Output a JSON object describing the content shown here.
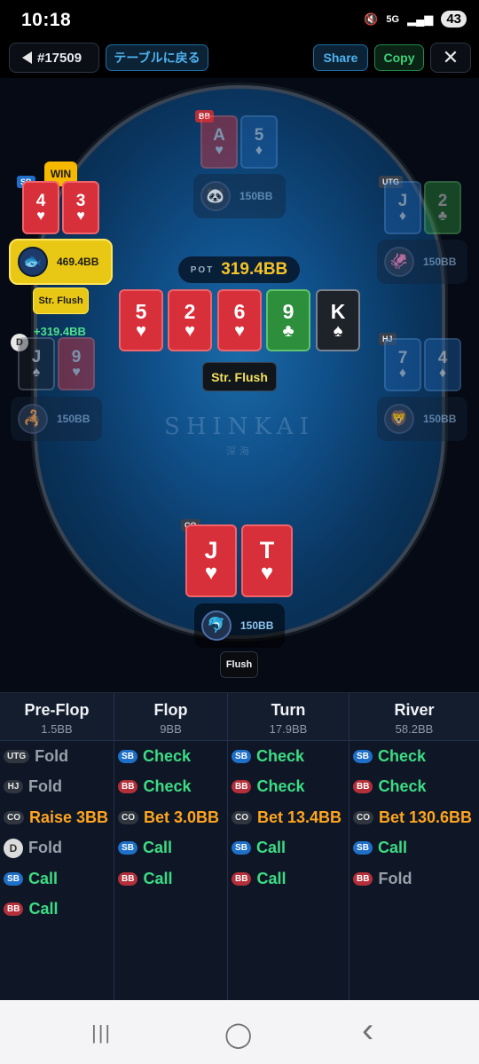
{
  "status_bar": {
    "time": "10:18",
    "mute": "🔇",
    "network": "5G",
    "signal": "▂▄▆",
    "battery": "43"
  },
  "top_bar": {
    "hand_id": "#17509",
    "return_label": "テーブルに戻る",
    "share_label": "Share",
    "copy_label": "Copy",
    "close_label": "✕"
  },
  "table": {
    "logo": "SHINKAI",
    "logo_sub": "深海",
    "pot_label": "POT",
    "pot": "319.4BB",
    "board": [
      {
        "rank": "5",
        "suit": "♥",
        "color": "red"
      },
      {
        "rank": "2",
        "suit": "♥",
        "color": "red"
      },
      {
        "rank": "6",
        "suit": "♥",
        "color": "red"
      },
      {
        "rank": "9",
        "suit": "♣",
        "color": "green"
      },
      {
        "rank": "K",
        "suit": "♠",
        "color": "black"
      }
    ],
    "hero_hand_label": "Str. Flush",
    "seats": {
      "bb": {
        "position": "BB",
        "cards": [
          {
            "rank": "A",
            "suit": "♥"
          },
          {
            "rank": "5",
            "suit": "♦"
          }
        ],
        "stack": "150BB",
        "avatar": "🐼"
      },
      "sb": {
        "position": "SB",
        "win_badge": "WIN",
        "cards": [
          {
            "rank": "4",
            "suit": "♥"
          },
          {
            "rank": "3",
            "suit": "♥"
          }
        ],
        "stack": "469.4BB",
        "avatar": "🐟",
        "hand_label": "Str. Flush",
        "win_amount": "+319.4BB"
      },
      "utg": {
        "position": "UTG",
        "cards": [
          {
            "rank": "J",
            "suit": "♦"
          },
          {
            "rank": "2",
            "suit": "♣"
          }
        ],
        "stack": "150BB",
        "avatar": "🦑"
      },
      "d": {
        "position": "D",
        "cards": [
          {
            "rank": "J",
            "suit": "♠"
          },
          {
            "rank": "9",
            "suit": "♥"
          }
        ],
        "stack": "150BB",
        "avatar": "🦂"
      },
      "hj": {
        "position": "HJ",
        "cards": [
          {
            "rank": "7",
            "suit": "♦"
          },
          {
            "rank": "4",
            "suit": "♦"
          }
        ],
        "stack": "150BB",
        "avatar": "🦁"
      },
      "co": {
        "position": "CO",
        "cards": [
          {
            "rank": "J",
            "suit": "♥"
          },
          {
            "rank": "T",
            "suit": "♥"
          }
        ],
        "stack": "150BB",
        "avatar": "🐬",
        "hand_label": "Flush"
      }
    }
  },
  "streets": [
    {
      "name": "Pre-Flop",
      "pot": "1.5BB",
      "actions": [
        {
          "pos": "UTG",
          "action": "Fold"
        },
        {
          "pos": "HJ",
          "action": "Fold"
        },
        {
          "pos": "CO",
          "action": "Raise 3BB"
        },
        {
          "pos": "D",
          "action": "Fold"
        },
        {
          "pos": "SB",
          "action": "Call"
        },
        {
          "pos": "BB",
          "action": "Call"
        }
      ]
    },
    {
      "name": "Flop",
      "pot": "9BB",
      "actions": [
        {
          "pos": "SB",
          "action": "Check"
        },
        {
          "pos": "BB",
          "action": "Check"
        },
        {
          "pos": "CO",
          "action": "Bet 3.0BB"
        },
        {
          "pos": "SB",
          "action": "Call"
        },
        {
          "pos": "BB",
          "action": "Call"
        }
      ]
    },
    {
      "name": "Turn",
      "pot": "17.9BB",
      "actions": [
        {
          "pos": "SB",
          "action": "Check"
        },
        {
          "pos": "BB",
          "action": "Check"
        },
        {
          "pos": "CO",
          "action": "Bet 13.4BB"
        },
        {
          "pos": "SB",
          "action": "Call"
        },
        {
          "pos": "BB",
          "action": "Call"
        }
      ]
    },
    {
      "name": "River",
      "pot": "58.2BB",
      "actions": [
        {
          "pos": "SB",
          "action": "Check"
        },
        {
          "pos": "BB",
          "action": "Check"
        },
        {
          "pos": "CO",
          "action": "Bet 130.6BB"
        },
        {
          "pos": "SB",
          "action": "Call"
        },
        {
          "pos": "BB",
          "action": "Fold"
        }
      ]
    }
  ],
  "nav": {
    "recents": "|||",
    "home": "◯",
    "back": "‹"
  }
}
